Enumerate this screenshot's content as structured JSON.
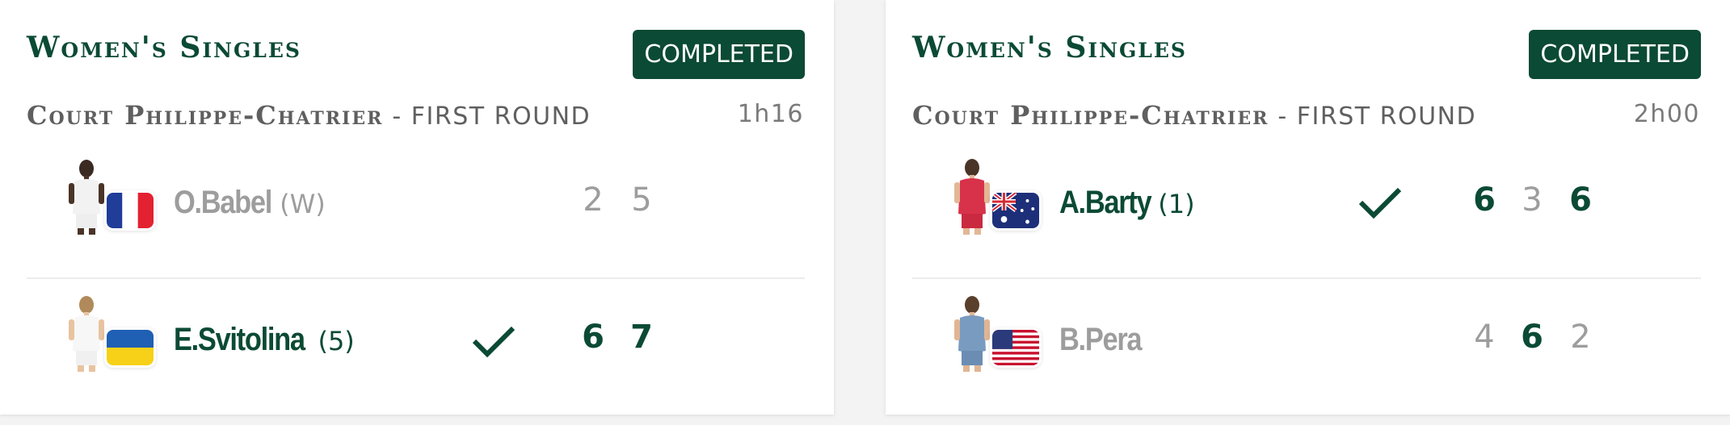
{
  "matches": [
    {
      "title": "Women's Singles",
      "status": "COMPLETED",
      "court": "Court Philippe-Chatrier",
      "separator": " - ",
      "round": "FIRST ROUND",
      "duration": "1h16",
      "players": [
        {
          "name": "O.Babel",
          "seed": "(W)",
          "country": "France",
          "winner": false,
          "sets": [
            "2",
            "5"
          ],
          "sets_won": [
            false,
            false
          ]
        },
        {
          "name": "E.Svitolina",
          "seed": "(5)",
          "country": "Ukraine",
          "winner": true,
          "sets": [
            "6",
            "7"
          ],
          "sets_won": [
            true,
            true
          ]
        }
      ]
    },
    {
      "title": "Women's Singles",
      "status": "COMPLETED",
      "court": "Court Philippe-Chatrier",
      "separator": " - ",
      "round": "FIRST ROUND",
      "duration": "2h00",
      "players": [
        {
          "name": "A.Barty",
          "seed": "(1)",
          "country": "Australia",
          "winner": true,
          "sets": [
            "6",
            "3",
            "6"
          ],
          "sets_won": [
            true,
            false,
            true
          ]
        },
        {
          "name": "B.Pera",
          "seed": "",
          "country": "United States",
          "winner": false,
          "sets": [
            "4",
            "6",
            "2"
          ],
          "sets_won": [
            false,
            true,
            false
          ]
        }
      ]
    }
  ],
  "colors": {
    "accent": "#0b4a34",
    "muted": "#9d9d9d",
    "background": "#f3f3f3"
  },
  "icons": {
    "winner": "checkmark-icon"
  }
}
